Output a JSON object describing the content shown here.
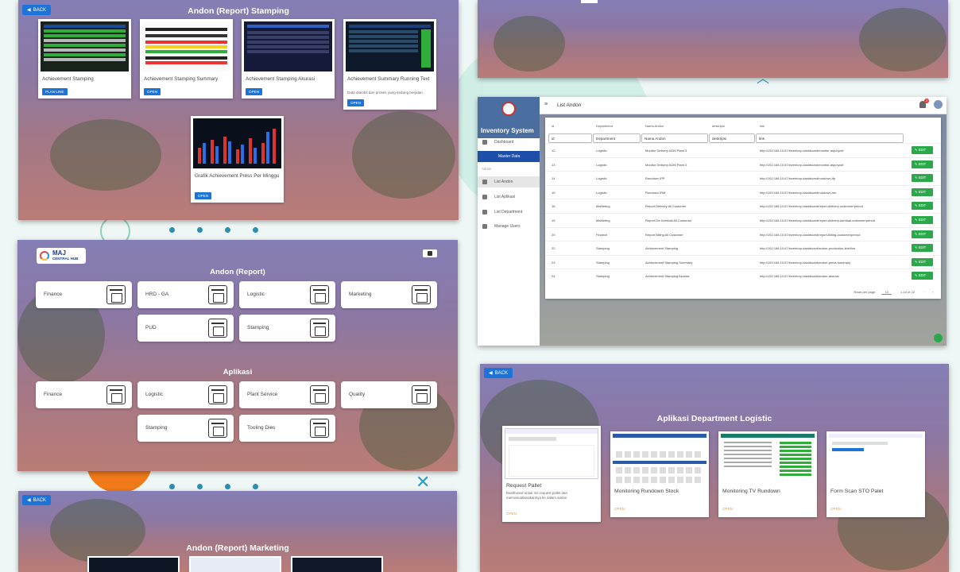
{
  "stamping_panel": {
    "back_label": "BACK",
    "title": "Andon (Report) Stamping",
    "cards": [
      {
        "name": "Achievement Stamping",
        "desc": "",
        "button": "PLAN LINE"
      },
      {
        "name": "Achievement Stamping Summary",
        "desc": "",
        "button": "OPEN"
      },
      {
        "name": "Achievement Stamping Akurasi",
        "desc": "",
        "button": "OPEN"
      },
      {
        "name": "Achievement Summary Running Text",
        "desc": "Data diambil dari proses yang sedang berjalan",
        "button": "OPEN"
      },
      {
        "name": "Grafik Achievement Press Per Minggu",
        "desc": "",
        "button": "OPEN"
      }
    ]
  },
  "hub_panel": {
    "logo_line1": "MAJ",
    "logo_line2": "CENTRAL HUB",
    "section_report": "Andon (Report)",
    "report_tiles": [
      "Finance",
      "HRD - GA",
      "Logistic",
      "Marketing",
      "PUD",
      "Stamping"
    ],
    "section_apps": "Aplikasi",
    "app_tiles": [
      "Finance",
      "Logistic",
      "Plant Service",
      "Quality",
      "Stamping",
      "Tooling Dies"
    ]
  },
  "marketing_panel": {
    "back_label": "BACK",
    "title": "Andon (Report) Marketing"
  },
  "inventory_panel": {
    "brand": "Inventory System",
    "page_title": "List Andon",
    "notif_count": "3",
    "menu": {
      "dashboard": "Dashboard",
      "master_data": "Master Data",
      "admin": "Admin",
      "list_andon": "List Andon",
      "list_aplikasi": "List Aplikasi",
      "list_department": "List Department",
      "manage_users": "Manage Users"
    },
    "headers": [
      "id",
      "Department",
      "Nama Andon",
      "deskripsi",
      "link"
    ],
    "filters": [
      "id",
      "Department",
      "Nama Andon",
      "deskripsi",
      "link"
    ],
    "rows": [
      {
        "id": "12",
        "dept": "Logistic",
        "name": "Monitor Delivery ADM Plant 3",
        "desc": "",
        "link": "http://192.168.10.67/inventory-dashboard/monitor-asp/cycle"
      },
      {
        "id": "13",
        "dept": "Logistic",
        "name": "Monitor Delivery ADM Plant 4",
        "desc": "",
        "link": "http://192.168.10.67/inventory-dashboard/monitor-asp/cycle"
      },
      {
        "id": "14",
        "dept": "Logistic",
        "name": "Rundown IPP",
        "desc": "",
        "link": "http://192.168.10.67/inventory-dashboard/rundown-ifp"
      },
      {
        "id": "15",
        "dept": "Logistic",
        "name": "Rundown IRM",
        "desc": "",
        "link": "http://192.168.10.67/inventory-dashboard/rundown-irm"
      },
      {
        "id": "16",
        "dept": "Marketing",
        "name": "Report Delivery All Customer",
        "desc": "",
        "link": "http://192.168.10.67/inventory-dashboard/report-delivery-customer/period"
      },
      {
        "id": "19",
        "dept": "Marketing",
        "name": "Report Div Kembali All Customer",
        "desc": "",
        "link": "http://192.168.10.67/inventory-dashboard/report-delivery-kembali-customer/period"
      },
      {
        "id": "20",
        "dept": "Finance",
        "name": "Report Billing All Customer",
        "desc": "",
        "link": "http://192.168.10.67/inventory-dashboard/report-billing-customer/period"
      },
      {
        "id": "22",
        "dept": "Stamping",
        "name": "Achievement Stamping",
        "desc": "",
        "link": "http://192.168.10.67/inventory-dashboard/andon-production-line/line"
      },
      {
        "id": "23",
        "dept": "Stamping",
        "name": "Achievement Stamping Summary",
        "desc": "",
        "link": "http://192.168.10.67/inventory-dashboard/andon-press-summary"
      },
      {
        "id": "24",
        "dept": "Stamping",
        "name": "Achievement Stamping Akurasi",
        "desc": "",
        "link": "http://192.168.10.67/inventory-dashboard/andon-akurasi"
      }
    ],
    "edit_label": "EDIT",
    "rows_per_page_label": "Rows per page:",
    "rows_per_page_value": "10",
    "page_range": "1-10 of 22"
  },
  "logistic_panel": {
    "back_label": "BACK",
    "title": "Aplikasi Department Logistic",
    "cards": [
      {
        "name": "Request Pallet",
        "desc": "Dashboard untuk me request pallet dan memvisualisasikannya ke dalam andon",
        "open": "OPEN"
      },
      {
        "name": "Monitoring Rundown Stock",
        "desc": "",
        "open": "OPEN"
      },
      {
        "name": "Monitoring TV Rundown",
        "desc": "",
        "open": "OPEN"
      },
      {
        "name": "Form Scan STO Palet",
        "desc": "",
        "open": "OPEN"
      }
    ]
  },
  "colors": {
    "primary_button": "#1d74d8",
    "edit_button": "#2aa84a",
    "accent_orange": "#f07a1a",
    "deco_teal": "#2a8fb0"
  }
}
